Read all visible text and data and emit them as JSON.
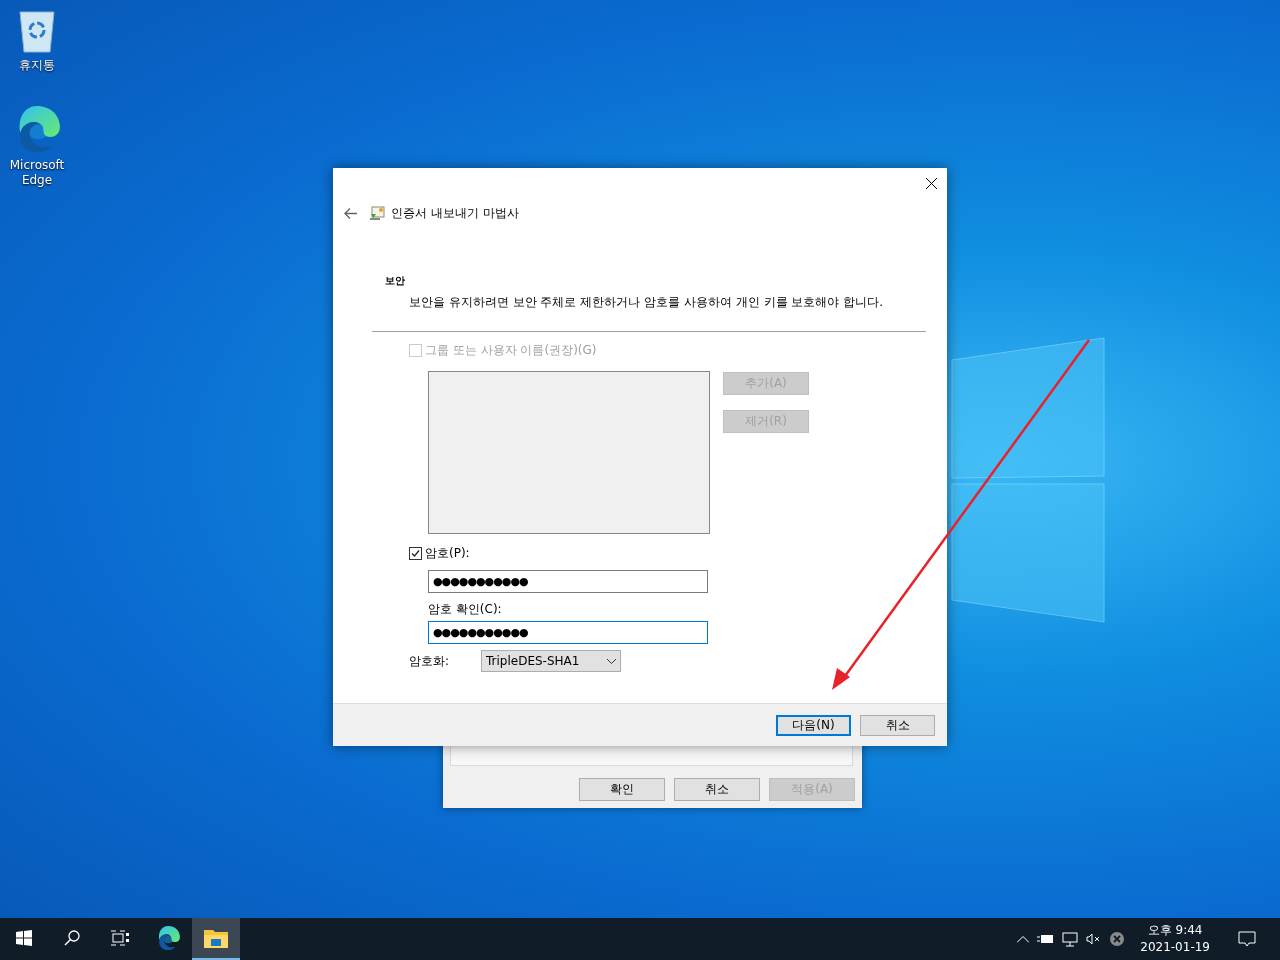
{
  "desktop_icons": [
    {
      "kind": "recycle-bin",
      "label": "휴지통"
    },
    {
      "kind": "edge",
      "label": "Microsoft Edge"
    }
  ],
  "background_window": {
    "buttons": [
      {
        "label": "확인",
        "disabled": false
      },
      {
        "label": "취소",
        "disabled": false
      },
      {
        "label": "적용(A)",
        "disabled": true
      }
    ]
  },
  "wizard": {
    "title": "인증서 내보내기 마법사",
    "section_title": "보안",
    "section_description": "보안을 유지하려면 보안 주체로 제한하거나 암호를 사용하여 개인 키를 보호해야 합니다.",
    "group_option": {
      "label": "그룹 또는 사용자 이름(권장)(G)",
      "checked": false,
      "disabled": true
    },
    "group_buttons": [
      {
        "label": "추가(A)",
        "disabled": true
      },
      {
        "label": "제거(R)",
        "disabled": true
      }
    ],
    "password_option": {
      "label": "암호(P):",
      "checked": true,
      "disabled": false
    },
    "password": {
      "value": "●●●●●●●●●●●",
      "focused": false
    },
    "confirm_label": "암호 확인(C):",
    "confirm_password": {
      "value": "●●●●●●●●●●●",
      "focused": true
    },
    "encryption": {
      "label": "암호화:",
      "value": "TripleDES-SHA1"
    },
    "buttons": [
      {
        "label": "다음(N)",
        "default": true
      },
      {
        "label": "취소",
        "default": false
      }
    ]
  },
  "taskbar": {
    "apps": [
      {
        "kind": "edge",
        "selected": false
      },
      {
        "kind": "explorer",
        "selected": true
      }
    ],
    "clock": {
      "time": "오후 9:44",
      "date": "2021-01-19"
    }
  }
}
